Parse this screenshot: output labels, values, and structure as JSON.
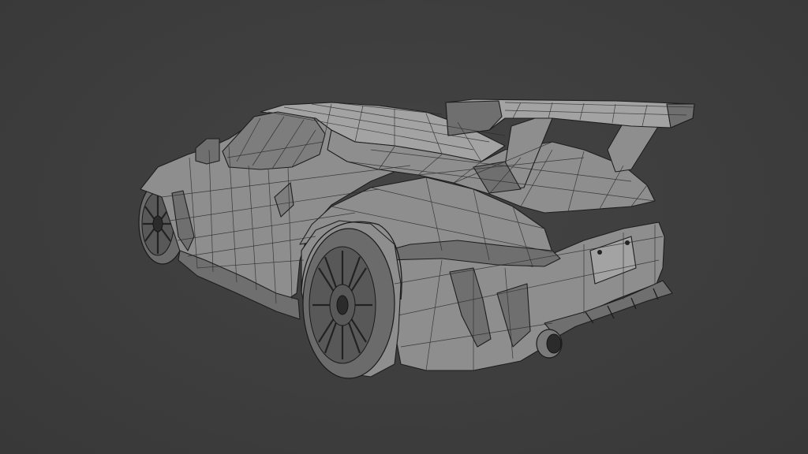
{
  "viewport": {
    "background": "#3d3d3d",
    "mode": "wireframe"
  },
  "model": {
    "wire_color": "#1e1e1e",
    "surface_color": "#8e8e8e"
  }
}
